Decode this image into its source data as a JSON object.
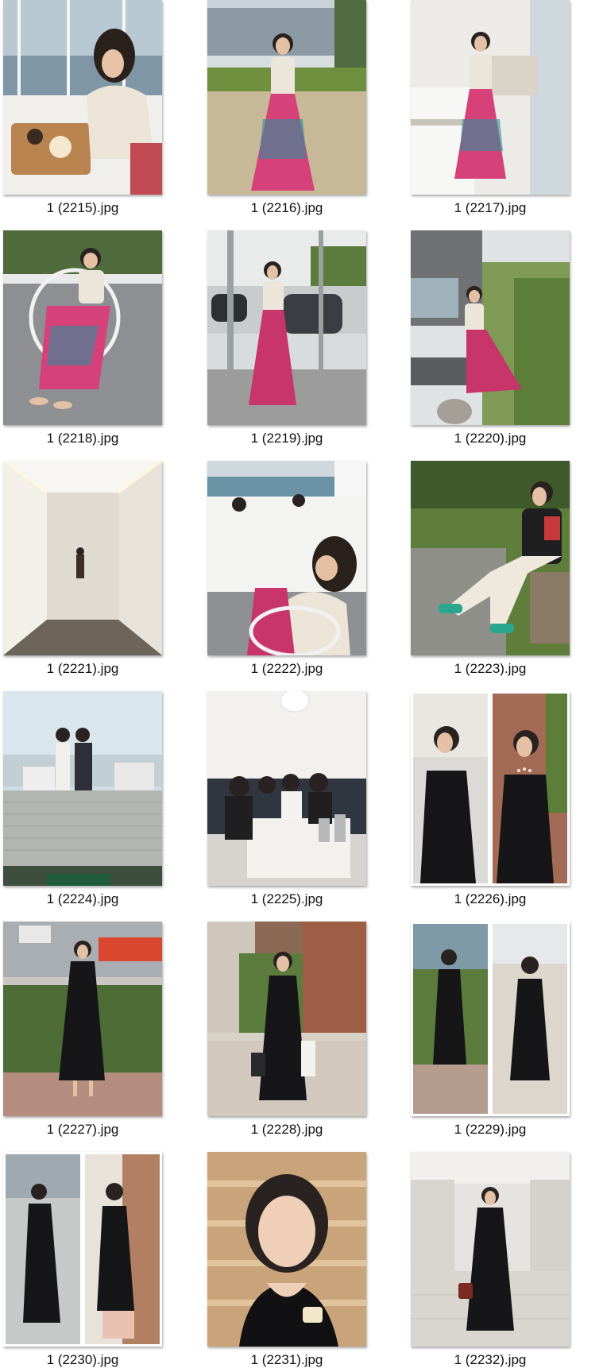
{
  "files": [
    {
      "name": "1 (2215).jpg",
      "thumb": "woman-cafe-window-photo"
    },
    {
      "name": "1 (2216).jpg",
      "thumb": "woman-floral-skirt-outdoor-photo"
    },
    {
      "name": "1 (2217).jpg",
      "thumb": "woman-floral-skirt-terrace-photo"
    },
    {
      "name": "1 (2218).jpg",
      "thumb": "woman-sitting-gravel-photo"
    },
    {
      "name": "1 (2219).jpg",
      "thumb": "woman-by-car-photo"
    },
    {
      "name": "1 (2220).jpg",
      "thumb": "woman-bench-garden-photo"
    },
    {
      "name": "1 (2221).jpg",
      "thumb": "corridor-photo"
    },
    {
      "name": "1 (2222).jpg",
      "thumb": "woman-beach-view-photo"
    },
    {
      "name": "1 (2223).jpg",
      "thumb": "woman-park-bench-photo"
    },
    {
      "name": "1 (2224).jpg",
      "thumb": "two-women-rooftop-photo"
    },
    {
      "name": "1 (2225).jpg",
      "thumb": "group-restaurant-photo"
    },
    {
      "name": "1 (2226).jpg",
      "thumb": "woman-black-dress-collage-photo"
    },
    {
      "name": "1 (2227).jpg",
      "thumb": "woman-black-dress-street-photo"
    },
    {
      "name": "1 (2228).jpg",
      "thumb": "woman-black-dress-plaza-photo"
    },
    {
      "name": "1 (2229).jpg",
      "thumb": "woman-black-dress-collage-2-photo"
    },
    {
      "name": "1 (2230).jpg",
      "thumb": "woman-black-dress-collage-3-photo"
    },
    {
      "name": "1 (2231).jpg",
      "thumb": "woman-portrait-photo"
    },
    {
      "name": "1 (2232).jpg",
      "thumb": "woman-mall-photo"
    }
  ]
}
